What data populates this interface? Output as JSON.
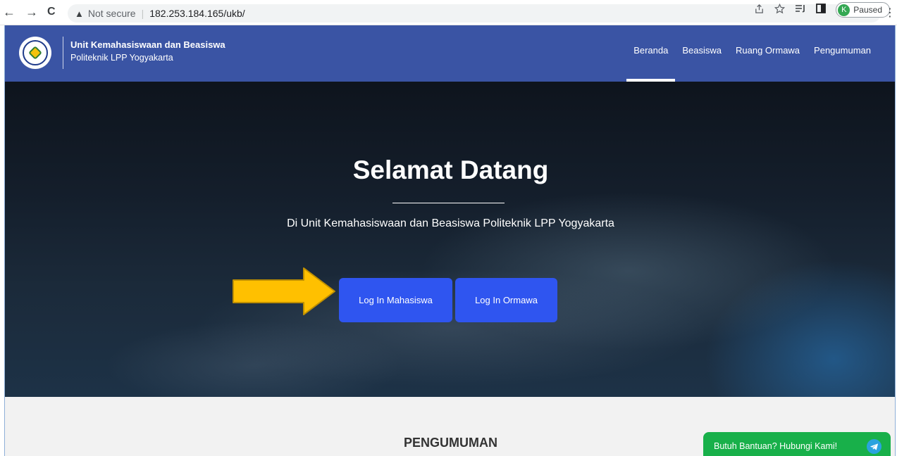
{
  "browser": {
    "back_glyph": "←",
    "forward_glyph": "→",
    "reload_glyph": "C",
    "security_warning_glyph": "▲",
    "security_label": "Not secure",
    "url": "182.253.184.165/ukb/",
    "profile_initial": "K",
    "profile_status": "Paused"
  },
  "site_header": {
    "brand_title": "Unit Kemahasiswaan dan Beasiswa",
    "brand_subtitle": "Politeknik LPP Yogyakarta",
    "nav": [
      {
        "label": "Beranda",
        "active": true
      },
      {
        "label": "Beasiswa",
        "active": false
      },
      {
        "label": "Ruang Ormawa",
        "active": false
      },
      {
        "label": "Pengumuman",
        "active": false
      }
    ],
    "bg_color": "#3a54a4"
  },
  "hero": {
    "title": "Selamat Datang",
    "subtitle": "Di Unit Kemahasiswaan dan Beasiswa Politeknik LPP Yogyakarta",
    "login_student_label": "Log In Mahasiswa",
    "login_ormawa_label": "Log In Ormawa",
    "button_color": "#2f55f0",
    "arrow_color": "#ffc000"
  },
  "announcements": {
    "section_title": "PENGUMUMAN"
  },
  "help_widget": {
    "label": "Butuh Bantuan? Hubungi Kami!",
    "icon": "telegram-icon",
    "bg_color": "#18b04a"
  }
}
